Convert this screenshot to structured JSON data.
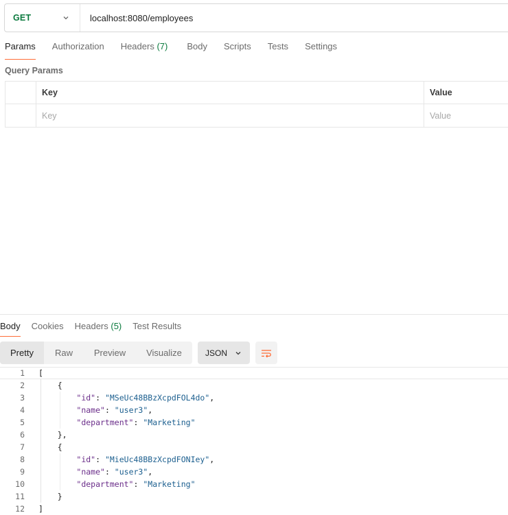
{
  "request": {
    "method": "GET",
    "url": "localhost:8080/employees"
  },
  "request_tabs": [
    {
      "label": "Params",
      "active": true
    },
    {
      "label": "Authorization"
    },
    {
      "label": "Headers",
      "count": "(7)"
    },
    {
      "label": "Body"
    },
    {
      "label": "Scripts"
    },
    {
      "label": "Tests"
    },
    {
      "label": "Settings"
    }
  ],
  "query_params": {
    "title": "Query Params",
    "header_key": "Key",
    "header_value": "Value",
    "placeholder_key": "Key",
    "placeholder_value": "Value"
  },
  "response_tabs": [
    {
      "label": "Body",
      "active": true
    },
    {
      "label": "Cookies"
    },
    {
      "label": "Headers",
      "count": "(5)"
    },
    {
      "label": "Test Results"
    }
  ],
  "view_modes": [
    {
      "label": "Pretty",
      "active": true
    },
    {
      "label": "Raw"
    },
    {
      "label": "Preview"
    },
    {
      "label": "Visualize"
    }
  ],
  "format": "JSON",
  "icons": {
    "method_dropdown": "chevron-down-icon",
    "format_dropdown": "chevron-down-icon",
    "wrap": "wrap-lines-icon"
  },
  "colors": {
    "accent": "#ff6c37",
    "method": "#0b7a3e",
    "json_key": "#6b2e8a",
    "json_string": "#1c5f8f"
  },
  "response_lines": [
    {
      "n": "1",
      "text": "["
    },
    {
      "n": "2",
      "text": "    {"
    },
    {
      "n": "3",
      "key": "\"id\"",
      "value": "\"MSeUc48BBzXcpdFOL4do\"",
      "tail": ","
    },
    {
      "n": "4",
      "key": "\"name\"",
      "value": "\"user3\"",
      "tail": ","
    },
    {
      "n": "5",
      "key": "\"department\"",
      "value": "\"Marketing\"",
      "tail": ""
    },
    {
      "n": "6",
      "text": "    },"
    },
    {
      "n": "7",
      "text": "    {"
    },
    {
      "n": "8",
      "key": "\"id\"",
      "value": "\"MieUc48BBzXcpdFONIey\"",
      "tail": ","
    },
    {
      "n": "9",
      "key": "\"name\"",
      "value": "\"user3\"",
      "tail": ","
    },
    {
      "n": "10",
      "key": "\"department\"",
      "value": "\"Marketing\"",
      "tail": ""
    },
    {
      "n": "11",
      "text": "    }"
    },
    {
      "n": "12",
      "text": "]"
    }
  ]
}
